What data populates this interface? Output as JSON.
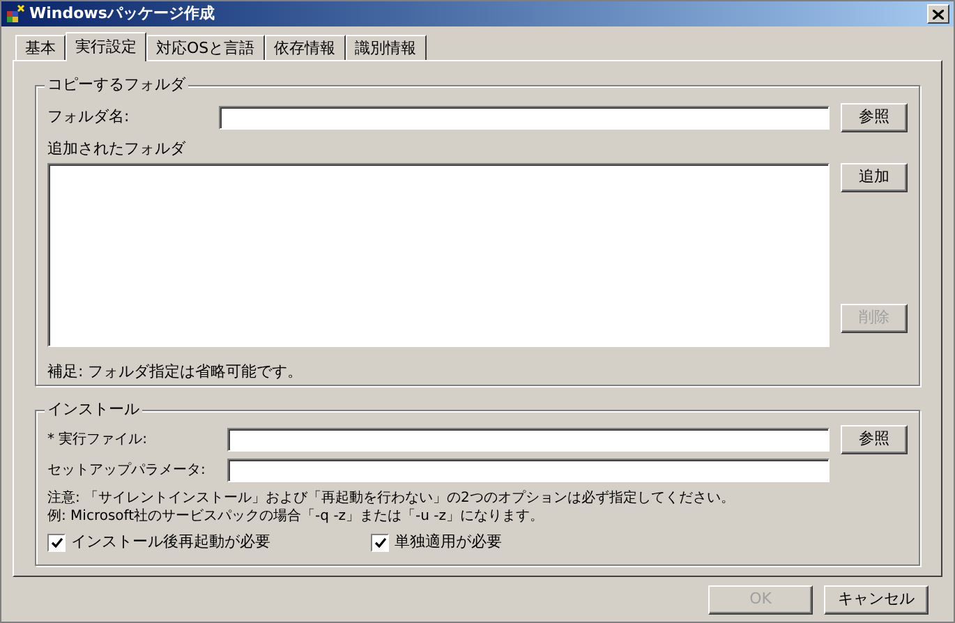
{
  "window": {
    "title": "Windowsパッケージ作成"
  },
  "tabs": [
    {
      "label": "基本",
      "selected": false
    },
    {
      "label": "実行設定",
      "selected": true
    },
    {
      "label": "対応OSと言語",
      "selected": false
    },
    {
      "label": "依存情報",
      "selected": false
    },
    {
      "label": "識別情報",
      "selected": false
    }
  ],
  "copy_group": {
    "legend": "コピーするフォルダ",
    "folder_label": "フォルダ名:",
    "browse_button": {
      "label": "参照",
      "disabled": false
    },
    "list_label": "追加されたフォルダ",
    "add_button": {
      "label": "追加",
      "disabled": false
    },
    "delete_button": {
      "label": "削除",
      "disabled": true
    },
    "note": "補足: フォルダ指定は省略可能です。"
  },
  "install_group": {
    "legend": "インストール",
    "fields": [
      {
        "label": "* 実行ファイル:",
        "button": "参照"
      },
      {
        "label": "セットアップパラメータ:"
      }
    ],
    "notes": [
      "注意: 「サイレントインストール」および「再起動を行わない」の2つのオプションは必ず指定してください。",
      "例: Microsoft社のサービスパックの場合「-q -z」または「-u -z」になります。"
    ],
    "checkboxes": [
      {
        "label": "インストール後再起動が必要",
        "checked": true
      },
      {
        "label": "単独適用が必要",
        "checked": true
      }
    ]
  },
  "buttons": [
    {
      "label": "OK",
      "disabled": true
    },
    {
      "label": "キャンセル",
      "disabled": false
    }
  ]
}
